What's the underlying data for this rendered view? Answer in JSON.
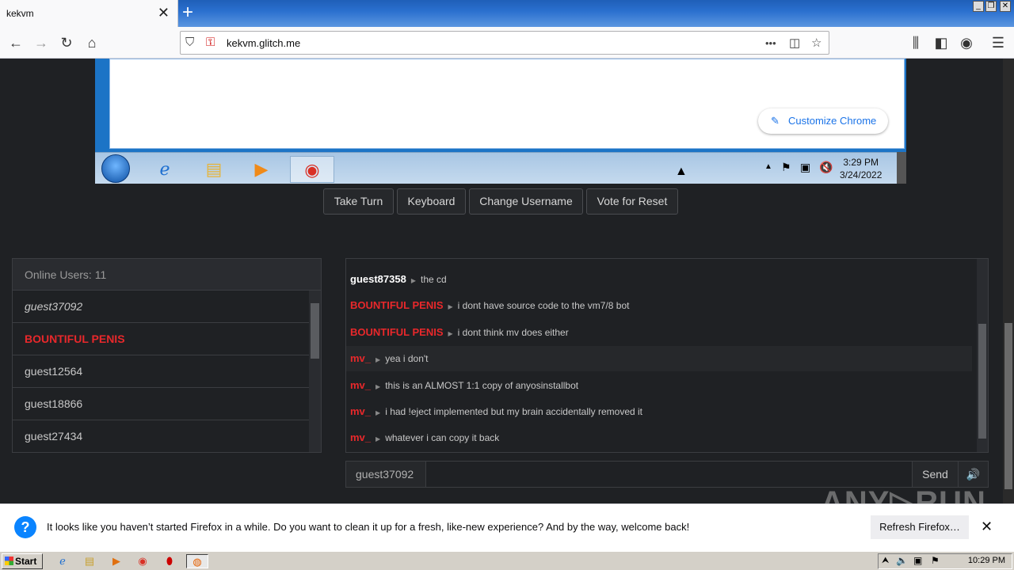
{
  "browser": {
    "tab_title": "kekvm",
    "tab_close": "✕",
    "new_tab": "+",
    "url": "kekvm.glitch.me",
    "more": "•••"
  },
  "vm": {
    "customize_label": "Customize Chrome",
    "clock_time": "3:29 PM",
    "clock_date": "3/24/2022"
  },
  "controls": {
    "take_turn": "Take Turn",
    "keyboard": "Keyboard",
    "change_username": "Change Username",
    "vote_reset": "Vote for Reset"
  },
  "users": {
    "header": "Online Users: 11",
    "items": [
      {
        "name": "guest37092",
        "style": "self"
      },
      {
        "name": "BOUNTIFUL PENIS",
        "style": "admin"
      },
      {
        "name": "guest12564",
        "style": "normal"
      },
      {
        "name": "guest18866",
        "style": "normal"
      },
      {
        "name": "guest27434",
        "style": "normal"
      }
    ]
  },
  "chat": {
    "messages": [
      {
        "user": "guest87358",
        "text": "the cd",
        "color": "#ffffff"
      },
      {
        "user": "BOUNTIFUL PENIS",
        "text": "i dont have source code to the vm7/8 bot",
        "color": "#e8282b"
      },
      {
        "user": "BOUNTIFUL PENIS",
        "text": "i dont think mv does either",
        "color": "#e8282b"
      },
      {
        "user": "mv_",
        "text": "yea i don't",
        "color": "#e8282b"
      },
      {
        "user": "mv_",
        "text": "this is an ALMOST 1:1 copy of anyosinstallbot",
        "color": "#e8282b"
      },
      {
        "user": "mv_",
        "text": "i had !eject implemented but my brain accidentally removed it",
        "color": "#e8282b"
      },
      {
        "user": "mv_",
        "text": "whatever i can copy it back",
        "color": "#e8282b"
      }
    ],
    "username": "guest37092",
    "input_value": "",
    "send_label": "Send",
    "volume_icon": "🔊"
  },
  "notification": {
    "icon": "?",
    "text": "It looks like you haven’t started Firefox in a while. Do you want to clean it up for a fresh, like-new experience? And by the way, welcome back!",
    "button": "Refresh Firefox…",
    "close": "✕"
  },
  "watermark": "ANY▷RUN",
  "host_taskbar": {
    "start_label": "Start",
    "clock": "10:29 PM"
  },
  "colors": {
    "admin_red": "#e8282b",
    "page_bg": "#1f2124"
  }
}
